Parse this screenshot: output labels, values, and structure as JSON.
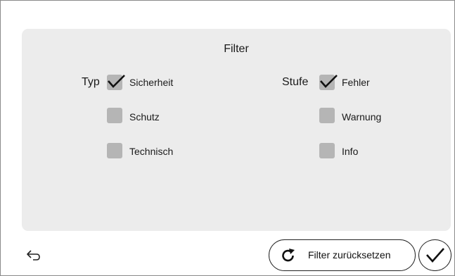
{
  "filter": {
    "title": "Filter",
    "type_group": {
      "label": "Typ",
      "options": [
        {
          "label": "Sicherheit",
          "checked": true
        },
        {
          "label": "Schutz",
          "checked": false
        },
        {
          "label": "Technisch",
          "checked": false
        }
      ]
    },
    "level_group": {
      "label": "Stufe",
      "options": [
        {
          "label": "Fehler",
          "checked": true
        },
        {
          "label": "Warnung",
          "checked": false
        },
        {
          "label": "Info",
          "checked": false
        }
      ]
    }
  },
  "footer": {
    "back_icon": "back-arrow-icon",
    "reset_label": "Filter zurücksetzen",
    "reset_icon": "refresh-icon",
    "confirm_icon": "checkmark-icon"
  },
  "colors": {
    "panel": "#ececec",
    "checkbox": "#b5b5b5",
    "border": "#8a8a8a"
  }
}
